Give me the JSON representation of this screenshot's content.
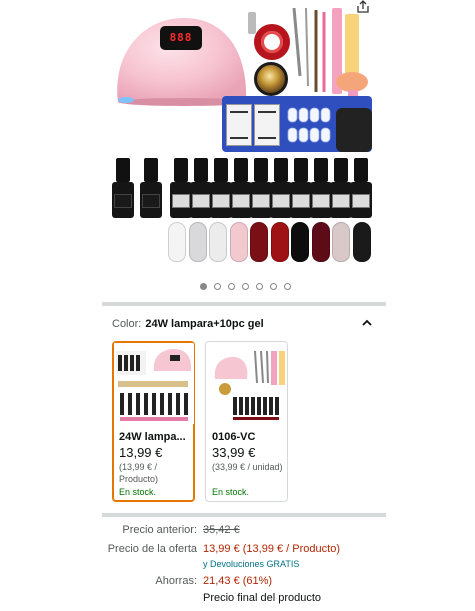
{
  "gallery": {
    "lamp_display": "888",
    "bottle_brand": "SHELLOVON",
    "dots_count": 7,
    "active_dot": 0,
    "swatch_colors": [
      "#f4f4f4",
      "#d9d9dc",
      "#ececec",
      "#f3c9d0",
      "#7b0f16",
      "#9e1114",
      "#0d0d0d",
      "#5e0b18",
      "#d8c9c8",
      "#1a1a1a"
    ]
  },
  "color_selector": {
    "label": "Color:",
    "selected_value": "24W lampara+10pc gel"
  },
  "variants": [
    {
      "title": "24W lampa...",
      "price": "13,99 €",
      "unit_price": "(13,99 € / Producto)",
      "stock": "En stock.",
      "selected": true
    },
    {
      "title": "0106-VC",
      "price": "33,99 €",
      "unit_price": "(33,99 € / unidad)",
      "stock": "En stock.",
      "selected": false
    }
  ],
  "pricing": {
    "previous_label": "Precio anterior:",
    "previous_value": "35,42 €",
    "offer_label": "Precio de la oferta",
    "offer_value": "13,99 € (13,99 € / Producto)",
    "returns_link": "y Devoluciones GRATIS",
    "savings_label": "Ahorras:",
    "savings_value": "21,43 € (61%)",
    "final_label": "Precio final del producto"
  },
  "colors": {
    "accent_orange": "#e77600",
    "price_red": "#b12704",
    "link_teal": "#007185",
    "stock_green": "#007600"
  }
}
